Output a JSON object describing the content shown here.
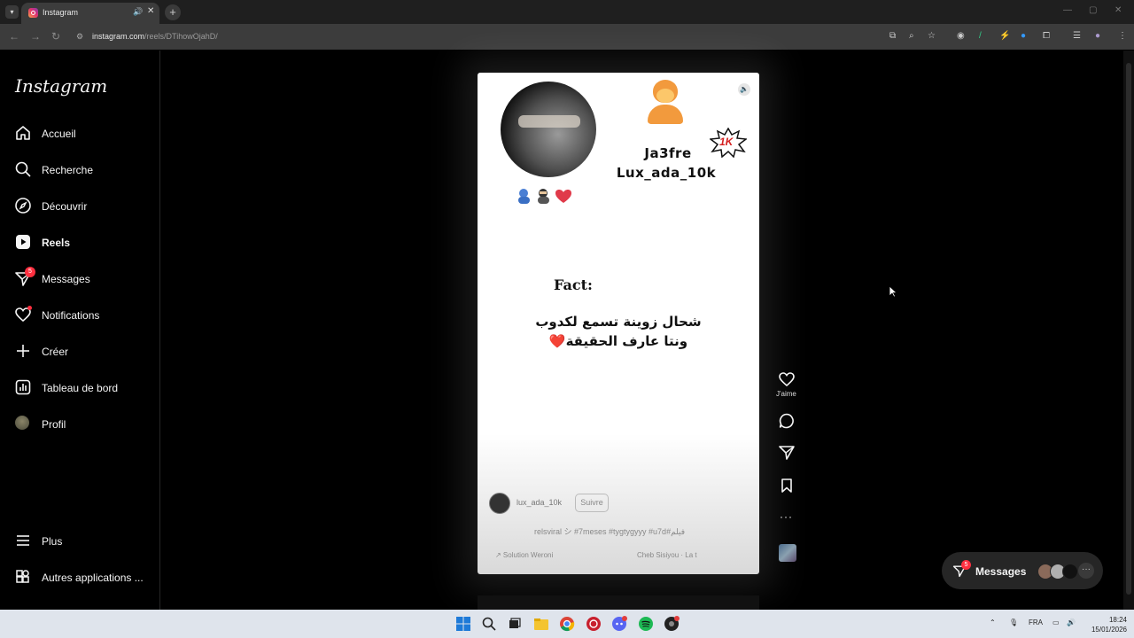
{
  "browser": {
    "tab_title": "Instagram",
    "url_host": "instagram.com",
    "url_path": "/reels/DTihowOjahD/"
  },
  "sidebar": {
    "logo": "Instagram",
    "items": [
      {
        "label": "Accueil",
        "icon": "home-icon"
      },
      {
        "label": "Recherche",
        "icon": "search-icon"
      },
      {
        "label": "Découvrir",
        "icon": "compass-icon"
      },
      {
        "label": "Reels",
        "icon": "reels-icon",
        "active": true
      },
      {
        "label": "Messages",
        "icon": "messenger-icon",
        "badge": "5"
      },
      {
        "label": "Notifications",
        "icon": "heart-icon"
      },
      {
        "label": "Créer",
        "icon": "plus-icon"
      },
      {
        "label": "Tableau de bord",
        "icon": "dashboard-icon"
      },
      {
        "label": "Profil",
        "icon": "avatar"
      },
      {
        "label": "Plus",
        "icon": "menu-icon"
      },
      {
        "label": "Autres applications ...",
        "icon": "apps-icon"
      }
    ]
  },
  "reel": {
    "name_line1": "Ja3fre",
    "name_line2": "Lux_ada_10k",
    "badge": "1K",
    "fact": "Fact:",
    "arabic_line1": "شحال زوينة تسمع لكدوب",
    "arabic_line2": "ونتا عارف الحقيقة❤️",
    "username": "lux_ada_10k",
    "follow": "Suivre",
    "tags": "relsviral シ #7meses #tygtygyyy #u7d#فيلم",
    "audio1": "↗ Solution Weroni",
    "audio2": "Cheb Sisiyou · La t"
  },
  "actions": {
    "like_label": "J'aime"
  },
  "messages_pill": {
    "label": "Messages",
    "badge": "5"
  },
  "taskbar": {
    "lang": "FRA",
    "time": "18:24",
    "date": "15/01/2026"
  },
  "colors": {
    "background": "#000000",
    "sidebar_border": "#262626",
    "badge_red": "#ff3040",
    "taskbar": "#dfe4ec"
  }
}
